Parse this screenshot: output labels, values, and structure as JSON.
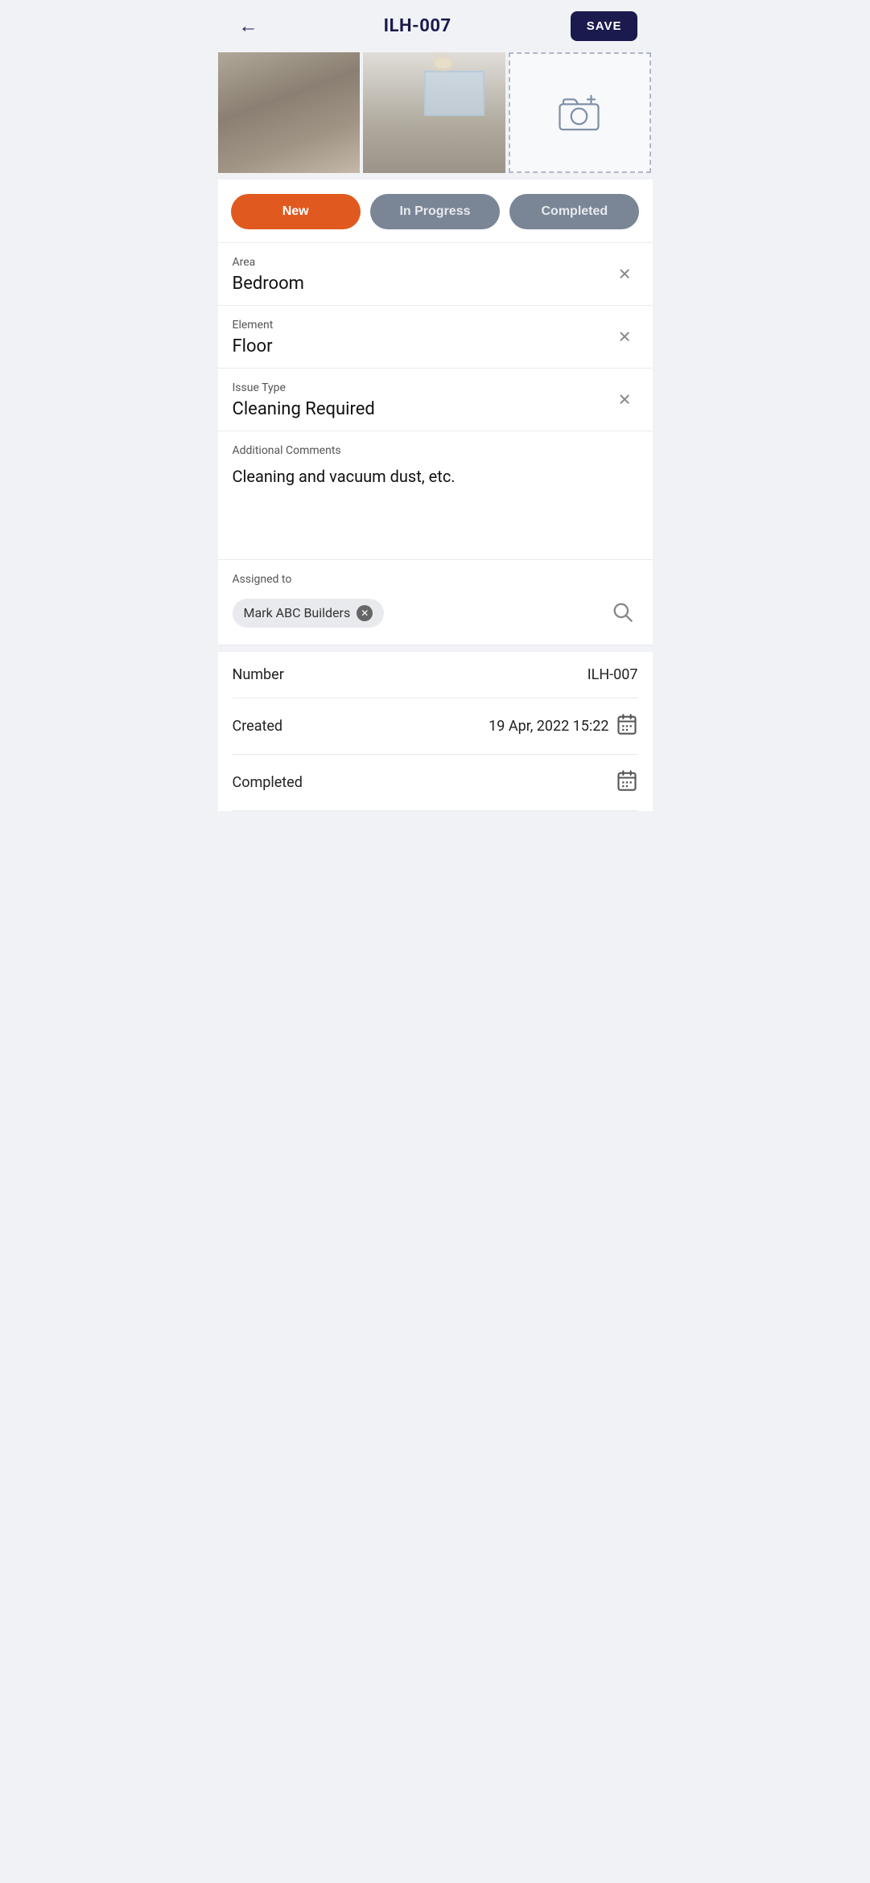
{
  "header": {
    "back_label": "←",
    "title": "ILH-007",
    "save_label": "SAVE"
  },
  "photos": {
    "add_label": "add photo"
  },
  "status": {
    "new_label": "New",
    "in_progress_label": "In Progress",
    "completed_label": "Completed",
    "active": "new"
  },
  "fields": {
    "area": {
      "label": "Area",
      "value": "Bedroom"
    },
    "element": {
      "label": "Element",
      "value": "Floor"
    },
    "issue_type": {
      "label": "Issue Type",
      "value": "Cleaning Required"
    }
  },
  "comments": {
    "label": "Additional Comments",
    "value": "Cleaning and vacuum dust, etc."
  },
  "assigned": {
    "label": "Assigned to",
    "assignee_name": "Mark ABC Builders"
  },
  "meta": {
    "number_label": "Number",
    "number_value": "ILH-007",
    "created_label": "Created",
    "created_value": "19 Apr, 2022 15:22",
    "completed_label": "Completed"
  }
}
